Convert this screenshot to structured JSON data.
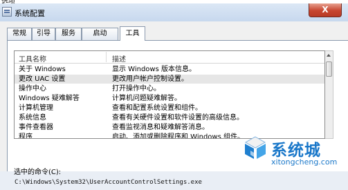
{
  "window": {
    "partial_top_text": "选项",
    "title": "系统配置",
    "close_label": "X"
  },
  "tabs": [
    {
      "label": "常规",
      "active": false
    },
    {
      "label": "引导",
      "active": false
    },
    {
      "label": "服务",
      "active": false
    },
    {
      "label": "启动",
      "active": false
    },
    {
      "label": "工具",
      "active": true
    }
  ],
  "table": {
    "headers": [
      "工具名称",
      "描述"
    ],
    "rows": [
      {
        "name": "关于 Windows",
        "desc": "显示 Windows 版本信息。",
        "selected": false
      },
      {
        "name": "更改 UAC 设置",
        "desc": "更改用户帐户控制设置。",
        "selected": true
      },
      {
        "name": "操作中心",
        "desc": "打开操作中心。",
        "selected": false
      },
      {
        "name": "Windows 疑难解答",
        "desc": "计算机问题疑难解答。",
        "selected": false
      },
      {
        "name": "计算机管理",
        "desc": "查看和配置系统设置和组件。",
        "selected": false
      },
      {
        "name": "系统信息",
        "desc": "查看有关硬件设置和软件设置的高级信息。",
        "selected": false
      },
      {
        "name": "事件查看器",
        "desc": "查看监视消息和疑难解答消息。",
        "selected": false
      },
      {
        "name": "程序",
        "desc": "启动、添加或删除程序和 Windows 组件。",
        "selected": false
      }
    ]
  },
  "command": {
    "label": "选中的命令(C):",
    "value": "C:\\Windows\\System32\\UserAccountControlSettings.exe"
  },
  "watermark": {
    "text": "系统城",
    "url": "xitongcheng.com"
  },
  "colors": {
    "accent": "#1977c9",
    "close": "#c7452f"
  }
}
